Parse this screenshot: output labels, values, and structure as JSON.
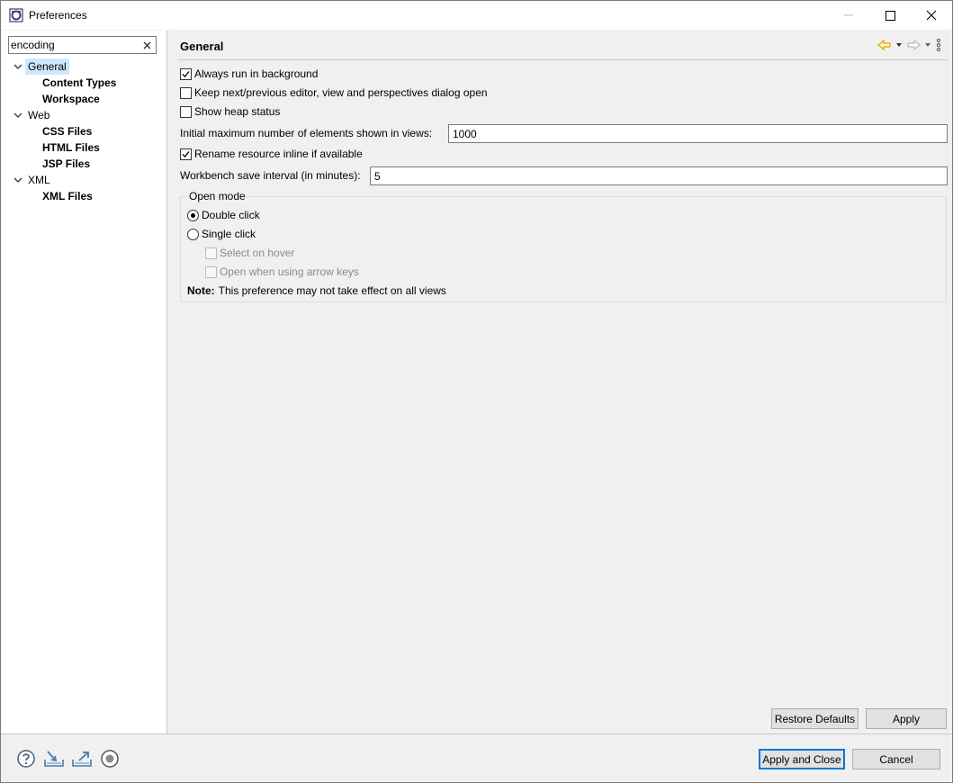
{
  "window": {
    "title": "Preferences"
  },
  "sidebar": {
    "filter_value": "encoding",
    "tree": [
      {
        "label": "General",
        "level": 0,
        "expanded": true,
        "selected": true
      },
      {
        "label": "Content Types",
        "level": 1
      },
      {
        "label": "Workspace",
        "level": 1
      },
      {
        "label": "Web",
        "level": 0,
        "expanded": true
      },
      {
        "label": "CSS Files",
        "level": 1
      },
      {
        "label": "HTML Files",
        "level": 1
      },
      {
        "label": "JSP Files",
        "level": 1
      },
      {
        "label": "XML",
        "level": 0,
        "expanded": true
      },
      {
        "label": "XML Files",
        "level": 1
      }
    ]
  },
  "page": {
    "title": "General",
    "options": [
      {
        "label": "Always run in background",
        "checked": true
      },
      {
        "label": "Keep next/previous editor, view and perspectives dialog open",
        "checked": false
      },
      {
        "label": "Show heap status",
        "checked": false
      },
      {
        "label": "Rename resource inline if available",
        "checked": true
      }
    ],
    "max_elements": {
      "label": "Initial maximum number of elements shown in views:",
      "value": "1000"
    },
    "save_interval": {
      "label": "Workbench save interval (in minutes):",
      "value": "5"
    },
    "open_mode": {
      "title": "Open mode",
      "double_click": "Double click",
      "single_click": "Single click",
      "selected": "Double click",
      "select_on_hover": "Select on hover",
      "open_arrow_keys": "Open when using arrow keys",
      "note_bold": "Note:",
      "note_text": "This preference may not take effect on all views"
    },
    "restore_defaults": "Restore Defaults",
    "apply": "Apply"
  },
  "footer": {
    "apply_and_close": "Apply and Close",
    "cancel": "Cancel",
    "icons": [
      "help-icon",
      "import-icon",
      "export-icon",
      "record-icon"
    ]
  },
  "colors": {
    "selection": "#cce8ff",
    "accent": "#0078d7",
    "nav_arrow": "#e8a200"
  }
}
